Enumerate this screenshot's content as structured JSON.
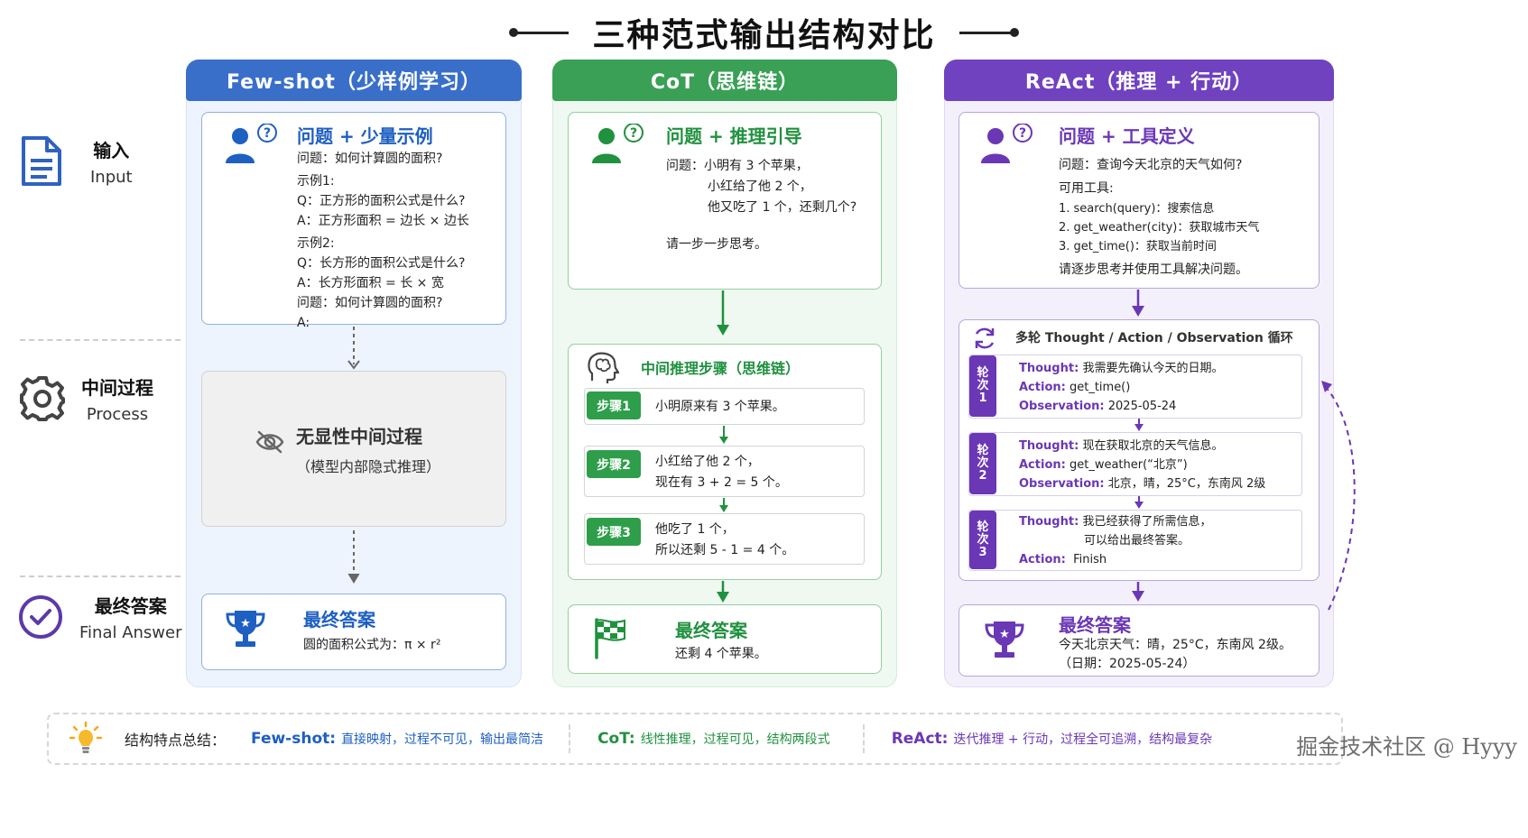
{
  "title": "三种范式输出结构对比",
  "stages": [
    {
      "zh": "输入",
      "en": "Input",
      "icon": "document-icon"
    },
    {
      "zh": "中间过程",
      "en": "Process",
      "icon": "gear-icon"
    },
    {
      "zh": "最终答案",
      "en": "Final Answer",
      "icon": "check-circle-icon"
    }
  ],
  "fewshot": {
    "header": "Few-shot（少样例学习）",
    "input_title": "问题 + 少量示例",
    "lines": [
      "问题：如何计算圆的面积?",
      "示例1:",
      "Q：正方形的面积公式是什么?",
      "A：正方形面积 = 边长 × 边长",
      "示例2:",
      "Q：长方形的面积公式是什么?",
      "A：长方形面积 = 长 × 宽",
      "问题：如何计算圆的面积?",
      "A:"
    ],
    "process_title": "无显性中间过程",
    "process_sub": "（模型内部隐式推理）",
    "answer_title": "最终答案",
    "answer_text": "圆的面积公式为：π × r²"
  },
  "cot": {
    "header": "CoT（思维链）",
    "input_title": "问题 + 推理引导",
    "q_label": "问题：",
    "q_lines": [
      "小明有 3 个苹果，",
      "小红给了他 2 个，",
      "他又吃了 1 个，还剩几个?"
    ],
    "guide": "请一步一步思考。",
    "process_title": "中间推理步骤（思维链）",
    "steps": [
      {
        "badge": "步骤1",
        "lines": [
          "小明原来有 3 个苹果。"
        ]
      },
      {
        "badge": "步骤2",
        "lines": [
          "小红给了他 2 个，",
          "现在有 3 + 2 = 5 个。"
        ]
      },
      {
        "badge": "步骤3",
        "lines": [
          "他吃了 1 个，",
          "所以还剩 5 - 1 = 4 个。"
        ]
      }
    ],
    "answer_title": "最终答案",
    "answer_text": "还剩 4 个苹果。"
  },
  "react": {
    "header": "ReAct（推理 + 行动）",
    "input_title": "问题 + 工具定义",
    "q": "问题：查询今天北京的天气如何?",
    "tools_label": "可用工具:",
    "tools": [
      "1.  search(query)：搜索信息",
      "2.  get_weather(city)：获取城市天气",
      "3.  get_time()：获取当前时间"
    ],
    "instruction": "请逐步思考并使用工具解决问题。",
    "loop_title": "多轮 Thought / Action / Observation 循环",
    "rounds": [
      {
        "badge": [
          "轮",
          "次",
          "1"
        ],
        "thought": "我需要先确认今天的日期。",
        "action": "get_time()",
        "observation": "2025-05-24"
      },
      {
        "badge": [
          "轮",
          "次",
          "2"
        ],
        "thought": "现在获取北京的天气信息。",
        "action": "get_weather(“北京”)",
        "observation": "北京，晴，25°C，东南风 2级"
      },
      {
        "badge": [
          "轮",
          "次",
          "3"
        ],
        "thought": "我已经获得了所需信息，",
        "thought2": "可以给出最终答案。",
        "action": "Finish"
      }
    ],
    "labels": {
      "thought": "Thought:",
      "action": "Action:",
      "observation": "Observation:"
    },
    "answer_title": "最终答案",
    "answer_lines": [
      "今天北京天气：晴，25°C，东南风 2级。",
      "（日期：2025-05-24）"
    ]
  },
  "summary": {
    "label": "结构特点总结：",
    "items": [
      {
        "kw": "Few-shot:",
        "desc": "直接映射，过程不可见，输出最简洁"
      },
      {
        "kw": "CoT:",
        "desc": "线性推理，过程可见，结构两段式"
      },
      {
        "kw": "ReAct:",
        "desc": "迭代推理 + 行动，过程全可追溯，结构最复杂"
      }
    ]
  },
  "watermark": "掘金技术社区 @ Hyyy",
  "colors": {
    "blue": "#3a6fc9",
    "green": "#2e9e4a",
    "purple": "#7042c0"
  }
}
